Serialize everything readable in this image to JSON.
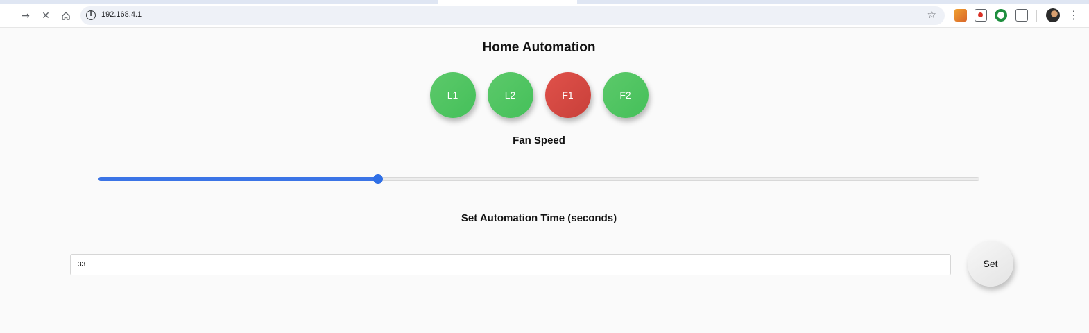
{
  "browser": {
    "url": "192.168.4.1",
    "icons": [
      "forward-icon",
      "stop-icon",
      "home-icon",
      "site-info-icon",
      "bookmark-star-icon",
      "extension-icon",
      "profile-avatar",
      "menu-icon"
    ]
  },
  "page": {
    "title": "Home Automation",
    "switches": [
      {
        "label": "L1",
        "state": "on",
        "color": "#4cc35f"
      },
      {
        "label": "L2",
        "state": "on",
        "color": "#4cc35f"
      },
      {
        "label": "F1",
        "state": "off",
        "color": "#d5463f"
      },
      {
        "label": "F2",
        "state": "on",
        "color": "#4cc35f"
      }
    ],
    "fan_speed": {
      "label": "Fan Speed",
      "value_fraction": 0.317,
      "accent": "#3b74e6"
    },
    "automation": {
      "label": "Set Automation Time (seconds)",
      "value": "33",
      "button_label": "Set"
    }
  }
}
